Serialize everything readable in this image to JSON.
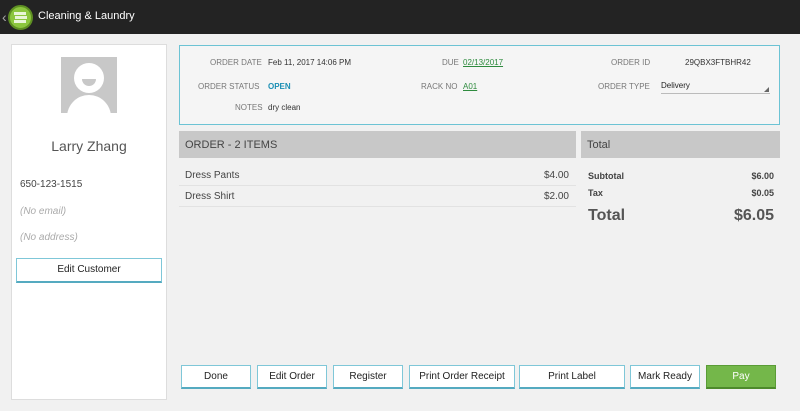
{
  "app": {
    "title": "Cleaning & Laundry",
    "back_icon": "chevron-left-icon",
    "logo_icon": "laundry-stack-icon"
  },
  "customer": {
    "name": "Larry Zhang",
    "phone": "650-123-1515",
    "email": "(No email)",
    "address": "(No address)",
    "edit_label": "Edit Customer",
    "avatar_icon": "user-avatar-icon"
  },
  "order_info": {
    "order_date_label": "ORDER DATE",
    "order_date": "Feb 11, 2017 14:06 PM",
    "due_label": "DUE",
    "due": "02/13/2017",
    "order_id_label": "ORDER ID",
    "order_id": "29QBX3FTBHR42",
    "status_label": "ORDER STATUS",
    "status": "OPEN",
    "rack_label": "RACK NO",
    "rack": "A01",
    "type_label": "ORDER TYPE",
    "type": "Delivery",
    "notes_label": "NOTES",
    "notes": "dry clean"
  },
  "items": {
    "header": "ORDER - 2 ITEMS",
    "rows": [
      {
        "name": "Dress Pants",
        "price": "$4.00"
      },
      {
        "name": "Dress Shirt",
        "price": "$2.00"
      }
    ]
  },
  "totals": {
    "header": "Total",
    "subtotal_label": "Subtotal",
    "subtotal": "$6.00",
    "tax_label": "Tax",
    "tax": "$0.05",
    "total_label": "Total",
    "total": "$6.05"
  },
  "actions": {
    "done": "Done",
    "edit_order": "Edit Order",
    "register": "Register",
    "print_receipt": "Print Order Receipt",
    "print_label": "Print Label",
    "mark_ready": "Mark Ready",
    "pay": "Pay"
  },
  "colors": {
    "accent_border": "#6cc3d4",
    "pay_green": "#74b74a",
    "status_blue": "#1b8fb4",
    "link_green": "#2e8b3e"
  }
}
